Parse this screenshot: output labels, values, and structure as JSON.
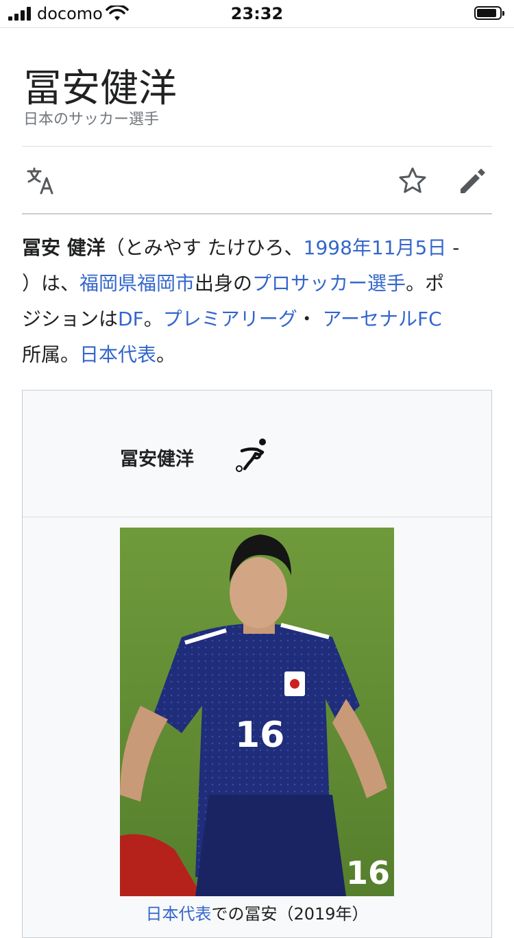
{
  "status_bar": {
    "carrier": "docomo",
    "time": "23:32"
  },
  "article": {
    "title": "冨安健洋",
    "description": "日本のサッカー選手"
  },
  "toolbar": {
    "icons": [
      "translate-icon",
      "star-icon",
      "edit-icon"
    ]
  },
  "lead": {
    "bold_name": "冨安 健洋",
    "reading": "（とみやす たけひろ、",
    "birthdate_link": "1998年11月5日",
    "dash": " -",
    "close_paren": "）は、",
    "birthplace_link": "福岡県福岡市",
    "born_in": "出身の",
    "profession_link": "プロサッカー選手",
    "period1": "。ポ",
    "position_text": "ジションは",
    "position_link": "DF",
    "period2": "。",
    "league_link": "プレミアリーグ",
    "dot": "・",
    "club_link": "アーセナルFC",
    "affiliation": "所属。",
    "national_link": "日本代表",
    "period3": "。"
  },
  "infobox": {
    "name": "冨安健洋",
    "caption_link": "日本代表",
    "caption_text": "での冨安（2019年）"
  },
  "colors": {
    "link": "#3366cc",
    "text": "#202122",
    "muted": "#72777d",
    "infobox_bg": "#f8f9fa"
  }
}
